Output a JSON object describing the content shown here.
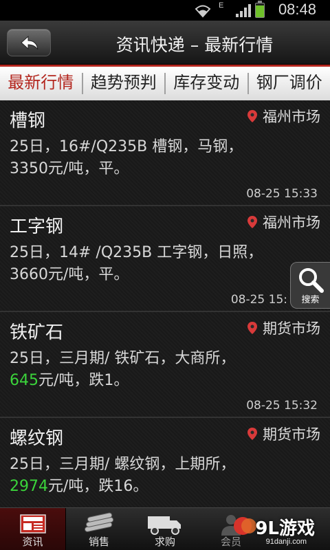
{
  "status_bar": {
    "time": "08:48",
    "network": "E",
    "icons": [
      "wifi-icon",
      "signal-icon",
      "battery-icon"
    ]
  },
  "header": {
    "title": "资讯快递 – 最新行情",
    "back_icon": "back-arrow-icon"
  },
  "tabs": [
    {
      "label": "最新行情",
      "active": true
    },
    {
      "label": "趋势预判",
      "active": false
    },
    {
      "label": "库存变动",
      "active": false
    },
    {
      "label": "钢厂调价",
      "active": false
    }
  ],
  "news": [
    {
      "title": "槽钢",
      "market": "福州市场",
      "line1": "25日，16#/Q235B 槽钢，马钢，",
      "price": "3350",
      "tail": "元/吨，平。",
      "time": "08-25 15:33"
    },
    {
      "title": "工字钢",
      "market": "福州市场",
      "line1": "25日，14# /Q235B 工字钢，日照，",
      "price": "3660",
      "tail": "元/吨，平。",
      "time": "08-25 15:"
    },
    {
      "title": "铁矿石",
      "market": "期货市场",
      "line1": "25日，三月期/ 铁矿石，大商所，",
      "price": "645",
      "tail": "元/吨，跌1。",
      "time": "08-25 15:32"
    },
    {
      "title": "螺纹钢",
      "market": "期货市场",
      "line1": "25日，三月期/ 螺纹钢，上期所，",
      "price": "2974",
      "tail": "元/吨，跌16。",
      "time": ""
    }
  ],
  "search": {
    "label": "搜索",
    "icon": "magnifier-icon"
  },
  "bottom_nav": [
    {
      "label": "资讯",
      "icon": "news-icon",
      "active": true
    },
    {
      "label": "销售",
      "icon": "steel-pipes-icon",
      "active": false
    },
    {
      "label": "求购",
      "icon": "truck-icon",
      "active": false
    },
    {
      "label": "会员",
      "icon": "member-icon",
      "active": false
    }
  ],
  "watermark": {
    "main": "9L游戏",
    "sub": "91danji.com"
  },
  "colors": {
    "accent_red": "#b3261e",
    "price_green": "#3bd43b",
    "pin_red": "#d83a3a"
  }
}
